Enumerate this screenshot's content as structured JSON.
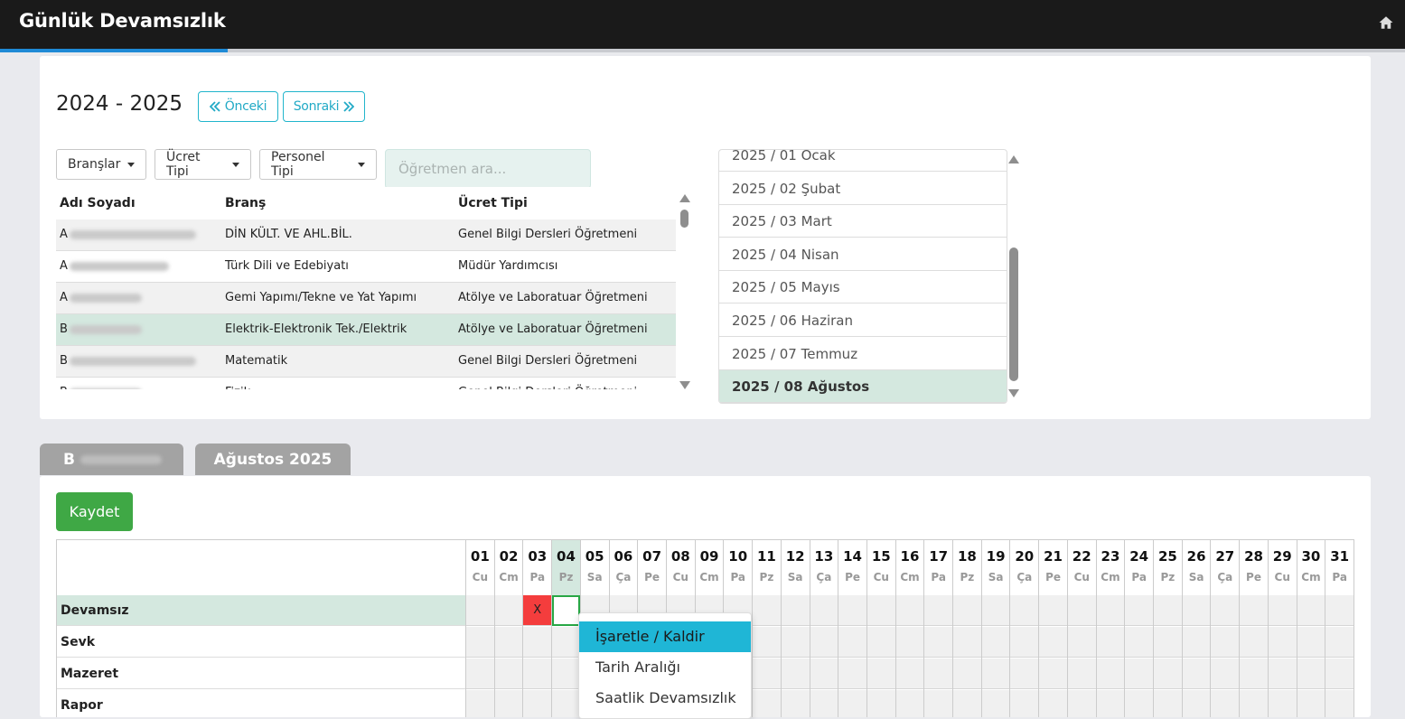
{
  "app": {
    "title": "Günlük Devamsızlık",
    "home_icon": "home-icon"
  },
  "period": {
    "label": "2024 - 2025",
    "prev_label": "Önceki",
    "next_label": "Sonraki"
  },
  "filters": {
    "branches_label": "Branşlar",
    "fee_type_label": "Ücret Tipi",
    "staff_type_label": "Personel Tipi",
    "search_placeholder": "Öğretmen ara..."
  },
  "teacher_table": {
    "headers": [
      "Adı Soyadı",
      "Branş",
      "Ücret Tipi"
    ],
    "rows": [
      {
        "initial": "A",
        "branch": "DİN KÜLT. VE AHL.BİL.",
        "fee": "Genel Bilgi Dersleri Öğretmeni"
      },
      {
        "initial": "A",
        "branch": "Türk Dili ve Edebiyatı",
        "fee": "Müdür Yardımcısı"
      },
      {
        "initial": "A",
        "branch": "Gemi Yapımı/Tekne ve Yat Yapımı",
        "fee": "Atölye ve Laboratuar Öğretmeni"
      },
      {
        "initial": "B",
        "branch": "Elektrik-Elektronik Tek./Elektrik",
        "fee": "Atölye ve Laboratuar Öğretmeni"
      },
      {
        "initial": "B",
        "branch": "Matematik",
        "fee": "Genel Bilgi Dersleri Öğretmeni"
      },
      {
        "initial": "B",
        "branch": "Fizik",
        "fee": "Genel Bilgi Dersleri Öğretmeni"
      }
    ],
    "selected_index": 3
  },
  "months": {
    "items": [
      "2025 / 01 Ocak",
      "2025 / 02 Şubat",
      "2025 / 03 Mart",
      "2025 / 04 Nisan",
      "2025 / 05 Mayıs",
      "2025 / 06 Haziran",
      "2025 / 07 Temmuz",
      "2025 / 08 Ağustos"
    ],
    "active_index": 7
  },
  "tabs": {
    "person_initial": "B",
    "month": "Ağustos 2025"
  },
  "actions": {
    "save_label": "Kaydet"
  },
  "calendar": {
    "days": [
      {
        "n": "01",
        "d": "Cu"
      },
      {
        "n": "02",
        "d": "Cm"
      },
      {
        "n": "03",
        "d": "Pa"
      },
      {
        "n": "04",
        "d": "Pz"
      },
      {
        "n": "05",
        "d": "Sa"
      },
      {
        "n": "06",
        "d": "Ça"
      },
      {
        "n": "07",
        "d": "Pe"
      },
      {
        "n": "08",
        "d": "Cu"
      },
      {
        "n": "09",
        "d": "Cm"
      },
      {
        "n": "10",
        "d": "Pa"
      },
      {
        "n": "11",
        "d": "Pz"
      },
      {
        "n": "12",
        "d": "Sa"
      },
      {
        "n": "13",
        "d": "Ça"
      },
      {
        "n": "14",
        "d": "Pe"
      },
      {
        "n": "15",
        "d": "Cu"
      },
      {
        "n": "16",
        "d": "Cm"
      },
      {
        "n": "17",
        "d": "Pa"
      },
      {
        "n": "18",
        "d": "Pz"
      },
      {
        "n": "19",
        "d": "Sa"
      },
      {
        "n": "20",
        "d": "Ça"
      },
      {
        "n": "21",
        "d": "Pe"
      },
      {
        "n": "22",
        "d": "Cu"
      },
      {
        "n": "23",
        "d": "Cm"
      },
      {
        "n": "24",
        "d": "Pa"
      },
      {
        "n": "25",
        "d": "Pz"
      },
      {
        "n": "26",
        "d": "Sa"
      },
      {
        "n": "27",
        "d": "Ça"
      },
      {
        "n": "28",
        "d": "Pe"
      },
      {
        "n": "29",
        "d": "Cu"
      },
      {
        "n": "30",
        "d": "Cm"
      },
      {
        "n": "31",
        "d": "Pa"
      }
    ],
    "rows": [
      "Devamsız",
      "Sevk",
      "Mazeret",
      "Rapor"
    ],
    "active_row": 0,
    "today_index": 3,
    "marks": [
      {
        "row": 0,
        "day": 2,
        "text": "X"
      }
    ],
    "selected_cell": {
      "row": 0,
      "day": 3
    },
    "mark_color": "#f43d3d"
  },
  "context_menu": {
    "items": [
      "İşaretle / Kaldir",
      "Tarih Aralığı",
      "Saatlik Devamsızlık"
    ],
    "highlighted_index": 0
  },
  "colors": {
    "accent": "#1f8ad6",
    "outline_button": "#22b5cc",
    "save": "#3fa845",
    "selected_row": "#d4e8df",
    "menu_highlight": "#1fb6d6"
  }
}
